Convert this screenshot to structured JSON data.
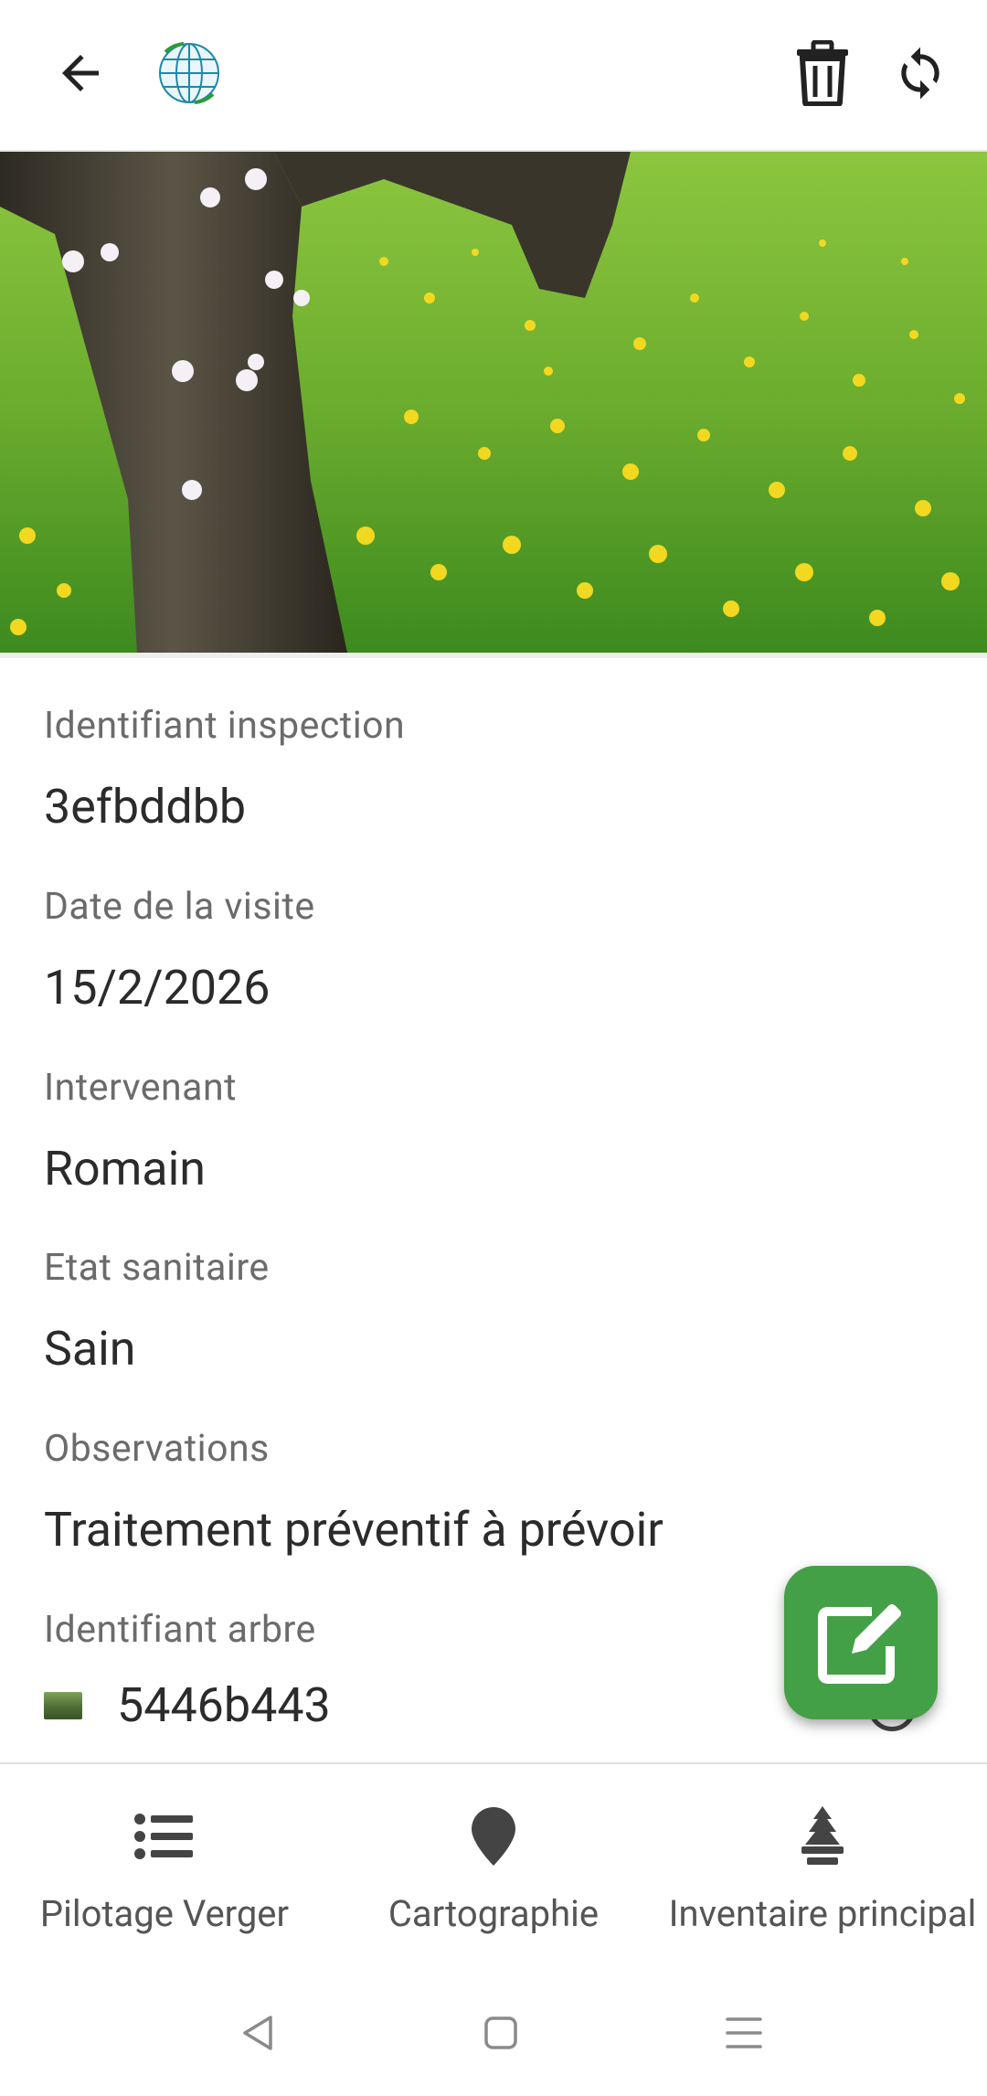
{
  "header": {
    "back_icon": "arrow-left-icon",
    "app_icon": "globe-sync-icon",
    "delete_icon": "trash-icon",
    "sync_icon": "sync-icon"
  },
  "hero": {
    "image": "orchard-tree-photo"
  },
  "fields": {
    "inspection_id": {
      "label": "Identifiant inspection",
      "value": "3efbddbb"
    },
    "visit_date": {
      "label": "Date de la visite",
      "value": "15/2/2026"
    },
    "intervenant": {
      "label": "Intervenant",
      "value": "Romain"
    },
    "health_state": {
      "label": "Etat sanitaire",
      "value": "Sain"
    },
    "observations": {
      "label": "Observations",
      "value": "Traitement préventif à prévoir"
    },
    "tree_id": {
      "label": "Identifiant arbre",
      "value": "5446b443"
    }
  },
  "fab": {
    "icon": "edit-icon",
    "color": "#43a047"
  },
  "bottom_nav": {
    "items": [
      {
        "label": "Pilotage Verger",
        "icon": "list-icon"
      },
      {
        "label": "Cartographie",
        "icon": "map-pin-icon"
      },
      {
        "label": "Inventaire principal",
        "icon": "tree-icon"
      }
    ]
  },
  "system_nav": {
    "back_icon": "triangle-back-icon",
    "home_icon": "square-home-icon",
    "menu_icon": "menu-icon"
  }
}
